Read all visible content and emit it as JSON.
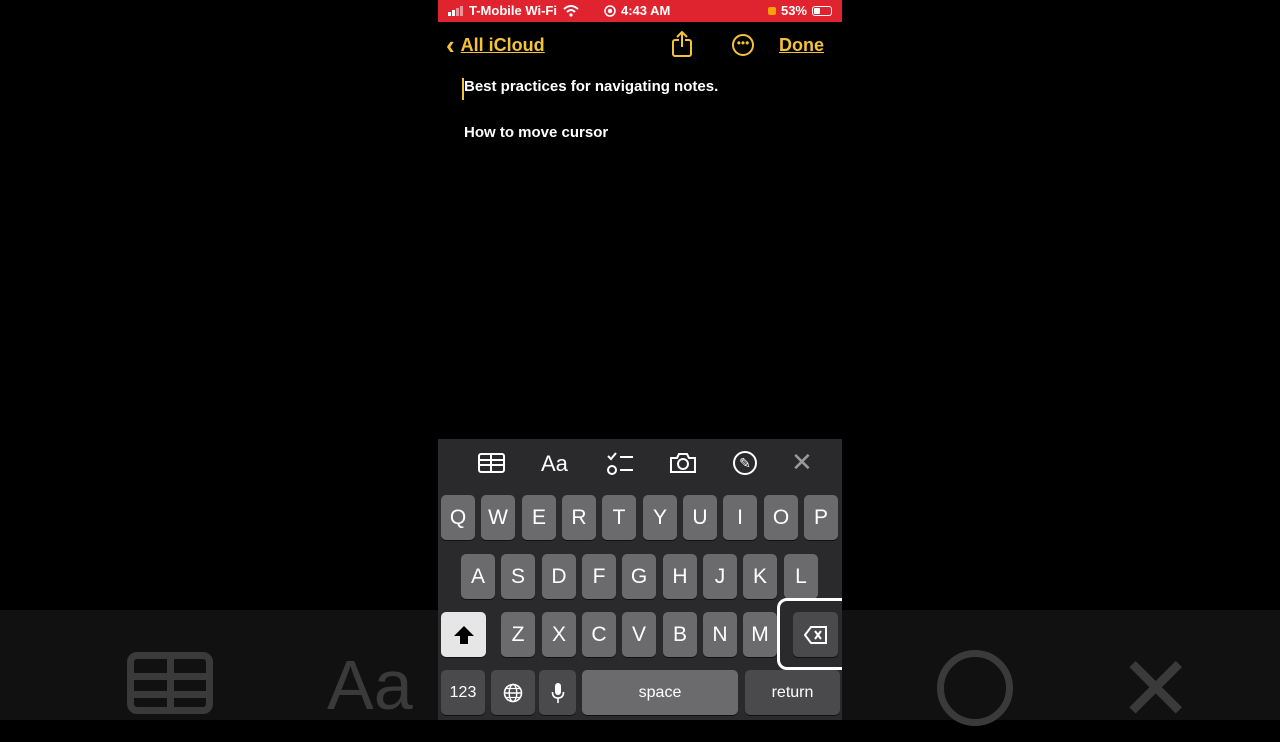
{
  "status_bar": {
    "carrier": "T-Mobile Wi-Fi",
    "time": "4:43 AM",
    "battery": "53%"
  },
  "nav": {
    "back_label": "All iCloud",
    "done_label": "Done"
  },
  "note": {
    "line1": "Best practices for navigating notes.",
    "line2": "How to move cursor"
  },
  "toolbar": {
    "format_label": "Aa"
  },
  "keyboard": {
    "row1": [
      "Q",
      "W",
      "E",
      "R",
      "T",
      "Y",
      "U",
      "I",
      "O",
      "P"
    ],
    "row2": [
      "A",
      "S",
      "D",
      "F",
      "G",
      "H",
      "J",
      "K",
      "L"
    ],
    "row3": [
      "Z",
      "X",
      "C",
      "V",
      "B",
      "N",
      "M"
    ],
    "numbers_label": "123",
    "space_label": "space",
    "return_label": "return"
  },
  "colors": {
    "accent": "#f5c338",
    "status_bar": "#e0242f",
    "keyboard_bg": "#2a2a2c",
    "key": "#6b6b6e"
  },
  "icons": [
    "chevron-left-icon",
    "share-icon",
    "more-icon",
    "table-icon",
    "checklist-icon",
    "camera-icon",
    "markup-icon",
    "close-icon",
    "shift-icon",
    "delete-icon",
    "globe-icon",
    "microphone-icon"
  ]
}
